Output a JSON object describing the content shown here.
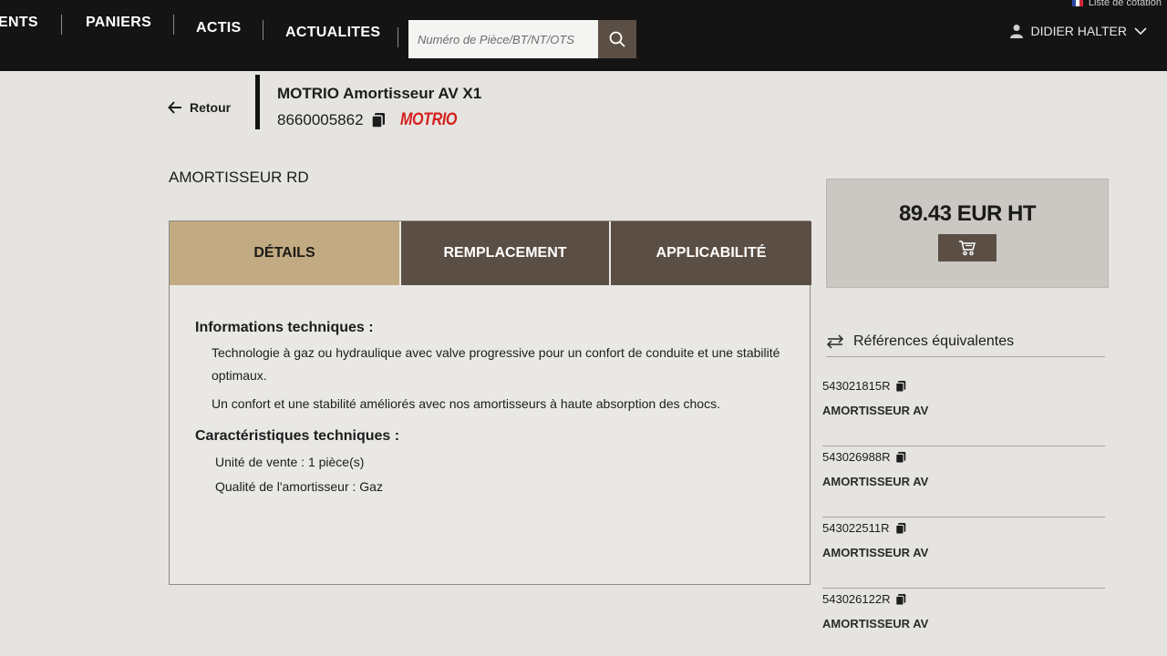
{
  "nav": {
    "items": [
      "ENTS",
      "PANIERS",
      "ACTIS",
      "ACTUALITES"
    ],
    "search_placeholder": "Numéro de Pièce/BT/NT/OTS",
    "cotation_label": "Liste de cotation",
    "user_name": "DIDIER HALTER"
  },
  "header": {
    "back_label": "Retour",
    "product_title": "MOTRIO Amortisseur AV X1",
    "part_number": "8660005862",
    "brand_logo": "MOTRIO"
  },
  "description": "AMORTISSEUR RD",
  "tabs": [
    "DÉTAILS",
    "REMPLACEMENT",
    "APPLICABILITÉ"
  ],
  "details": {
    "info_title": "Informations techniques :",
    "paragraphs": [
      "Technologie à gaz ou hydraulique avec valve progressive pour un confort de conduite et une stabilité optimaux.",
      "Un confort et une stabilité améliorés avec nos amortisseurs à haute absorption des chocs."
    ],
    "specs_title": "Caractéristiques techniques :",
    "specs": [
      "Unité de vente : 1 pièce(s)",
      "Qualité de l'amortisseur : Gaz"
    ]
  },
  "price": {
    "value": "89.43 EUR HT"
  },
  "equivalents": {
    "title": "Références équivalentes",
    "items": [
      {
        "ref": "543021815R",
        "name": "AMORTISSEUR AV"
      },
      {
        "ref": "543026988R",
        "name": "AMORTISSEUR AV"
      },
      {
        "ref": "543022511R",
        "name": "AMORTISSEUR AV"
      },
      {
        "ref": "543026122R",
        "name": "AMORTISSEUR AV"
      }
    ]
  },
  "colors": {
    "topbar": "#141414",
    "tab_active": "#c2ab82",
    "tab_inactive": "#5b4e44",
    "brand_red": "#d3201e",
    "background": "#e6e4e0"
  },
  "icons": [
    "search-icon",
    "user-icon",
    "chevron-down-icon",
    "arrow-left-icon",
    "copy-icon",
    "cart-icon",
    "swap-icon",
    "flag-icon"
  ]
}
